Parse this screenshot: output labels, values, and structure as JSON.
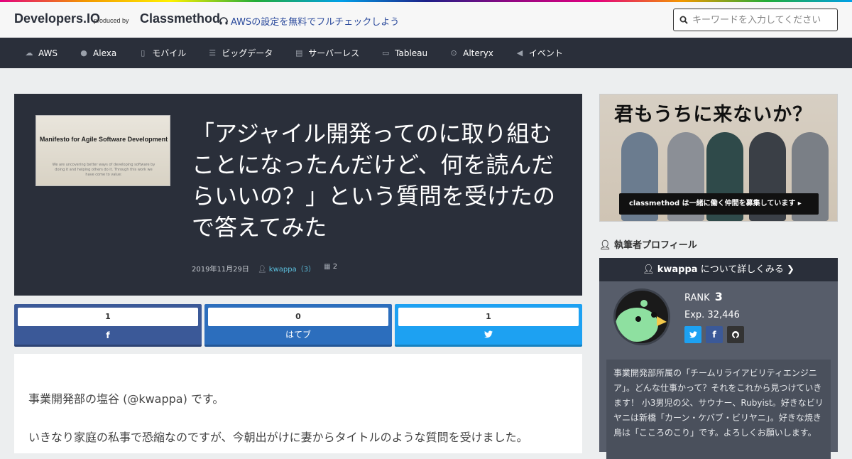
{
  "header": {
    "logo": "Developers.IO",
    "produced_by": "produced by",
    "company": "Classmethod",
    "promo": "AWSの設定を無料でフルチェックしよう",
    "search_placeholder": "キーワードを入力してください"
  },
  "nav": {
    "items": [
      {
        "label": "AWS",
        "icon": "cloud-icon"
      },
      {
        "label": "Alexa",
        "icon": "microphone-icon"
      },
      {
        "label": "モバイル",
        "icon": "mobile-icon"
      },
      {
        "label": "ビッグデータ",
        "icon": "list-icon"
      },
      {
        "label": "サーバーレス",
        "icon": "server-icon"
      },
      {
        "label": "Tableau",
        "icon": "desktop-icon"
      },
      {
        "label": "Alteryx",
        "icon": "circle-arrow-icon"
      },
      {
        "label": "イベント",
        "icon": "volume-icon"
      }
    ]
  },
  "article": {
    "thumbnail_title": "Manifesto for Agile Software Development",
    "thumbnail_body": "We are uncovering better ways of developing software by doing it and helping others do it. Through this work we have come to value:",
    "title": "「アジャイル開発ってのに取り組むことになったんだけど、何を読んだらいいの？」という質問を受けたので答えてみた",
    "date": "2019年11月29日",
    "author": "kwappa（3）",
    "views": "2",
    "paragraphs": [
      "事業開発部の塩谷 (@kwappa) です。",
      "いきなり家庭の私事で恐縮なのですが、今朝出がけに妻からタイトルのような質問を受けました。"
    ]
  },
  "share": {
    "facebook_count": "1",
    "facebook_label": "f",
    "hatena_count": "0",
    "hatena_label": "はてブ",
    "twitter_count": "1"
  },
  "sidebar": {
    "banner_title": "君もうちに来ないか？",
    "banner_bar": "classmethod は一緒に働く仲間を募集しています ▸",
    "profile_label": "執筆者プロフィール",
    "profile_name": "kwappa",
    "profile_suffix": "について詳しくみる",
    "rank_label": "RANK",
    "rank_value": "3",
    "exp": "Exp. 32,446",
    "bio": "事業開発部所属の「チームリライアビリティエンジニア」。どんな仕事かって？それをこれから見つけていきます！ 小3男児の父、サウナー、Rubyist。好きなビリヤニは新橋「カーン・ケバブ・ビリヤニ」。好きな焼き鳥は「こころのこり」です。よろしくお願いします。"
  },
  "colors": {
    "dark": "#2a2f3a",
    "facebook": "#3b5998",
    "hatena": "#2c6ebd",
    "twitter": "#1da1f2",
    "link": "#5bc0de"
  }
}
